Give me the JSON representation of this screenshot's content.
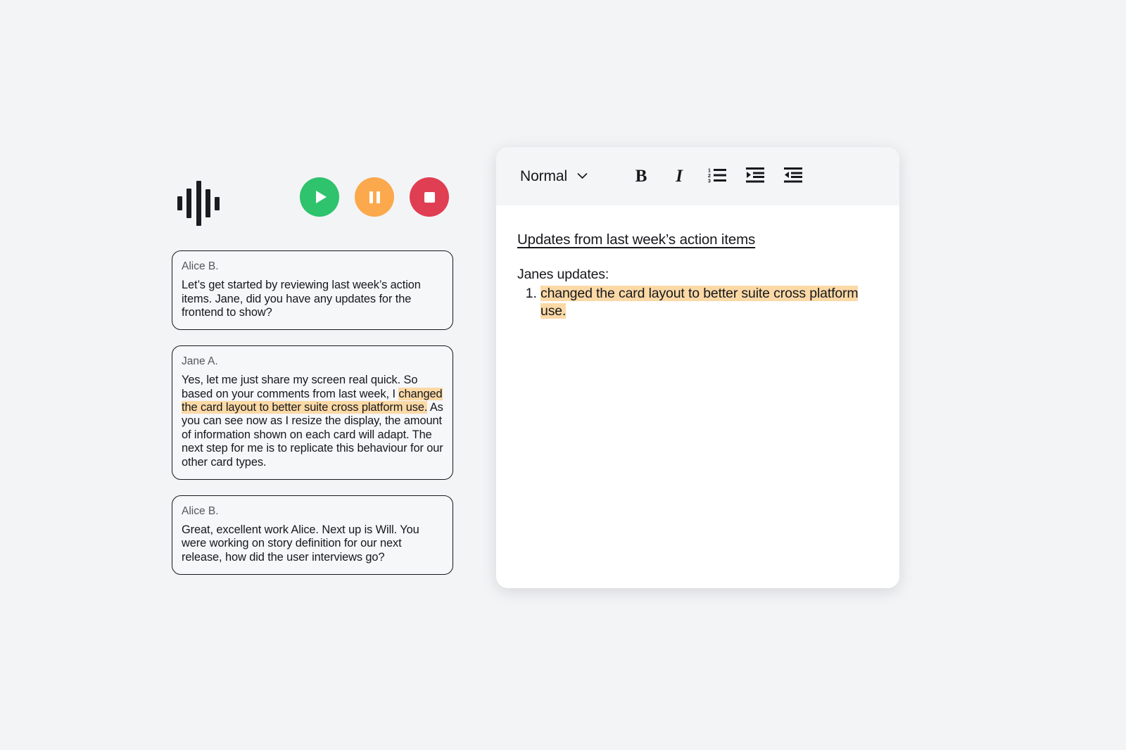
{
  "colors": {
    "page_background": "#f3f4f6",
    "play_green": "#2ec36c",
    "pause_orange": "#fba94c",
    "stop_red": "#e03e52",
    "highlight_peach": "#fbd9a6",
    "toolbar_gray": "#f4f5f6",
    "card_border": "#16161c"
  },
  "player": {
    "waveform_icon": "audio-waveform-icon",
    "bars": [
      20,
      42,
      64,
      40,
      19
    ],
    "buttons": [
      {
        "name": "play-button",
        "icon": "play-icon",
        "label": "Play",
        "color": "#2ec36c"
      },
      {
        "name": "pause-button",
        "icon": "pause-icon",
        "label": "Pause",
        "color": "#fba94c"
      },
      {
        "name": "stop-button",
        "icon": "stop-icon",
        "label": "Stop",
        "color": "#e03e52"
      }
    ]
  },
  "transcript": {
    "messages": [
      {
        "speaker": "Alice B.",
        "segments": [
          {
            "text": "Let’s get started by reviewing last week’s action items. Jane, did you have any updates for the frontend to show?",
            "highlight": false
          }
        ]
      },
      {
        "speaker": "Jane A.",
        "segments": [
          {
            "text": "Yes, let me just share my screen real quick. So based on your comments from last week, I ",
            "highlight": false
          },
          {
            "text": "changed the card layout to better suite cross platform use.",
            "highlight": true
          },
          {
            "text": " As you can see now as I resize the display, the amount of information shown on each card will adapt. The next step for me is to replicate this behaviour for our other card types.",
            "highlight": false
          }
        ]
      },
      {
        "speaker": "Alice B.",
        "segments": [
          {
            "text": "Great, excellent work Alice. Next up is Will. You were working on story definition for our next release, how did the user interviews go?",
            "highlight": false
          }
        ]
      }
    ]
  },
  "editor": {
    "toolbar": {
      "style_select": {
        "selected": "Normal",
        "chevron_icon": "chevron-down-icon",
        "options": [
          "Normal"
        ]
      },
      "tools": [
        {
          "name": "bold-button",
          "icon": "bold-icon",
          "glyph": "B",
          "label": "Bold"
        },
        {
          "name": "italic-button",
          "icon": "italic-icon",
          "glyph": "I",
          "label": "Italic"
        },
        {
          "name": "numbered-list-button",
          "icon": "numbered-list-icon",
          "glyph": "",
          "label": "Numbered list"
        },
        {
          "name": "indent-button",
          "icon": "indent-increase-icon",
          "glyph": "",
          "label": "Increase indent"
        },
        {
          "name": "outdent-button",
          "icon": "indent-decrease-icon",
          "glyph": "",
          "label": "Decrease indent"
        }
      ]
    },
    "document": {
      "title": "Updates from last week’s action items",
      "intro": "Janes updates:",
      "list_items": [
        {
          "text": "changed the card layout to better suite cross platform use.",
          "highlight": true
        }
      ]
    }
  }
}
